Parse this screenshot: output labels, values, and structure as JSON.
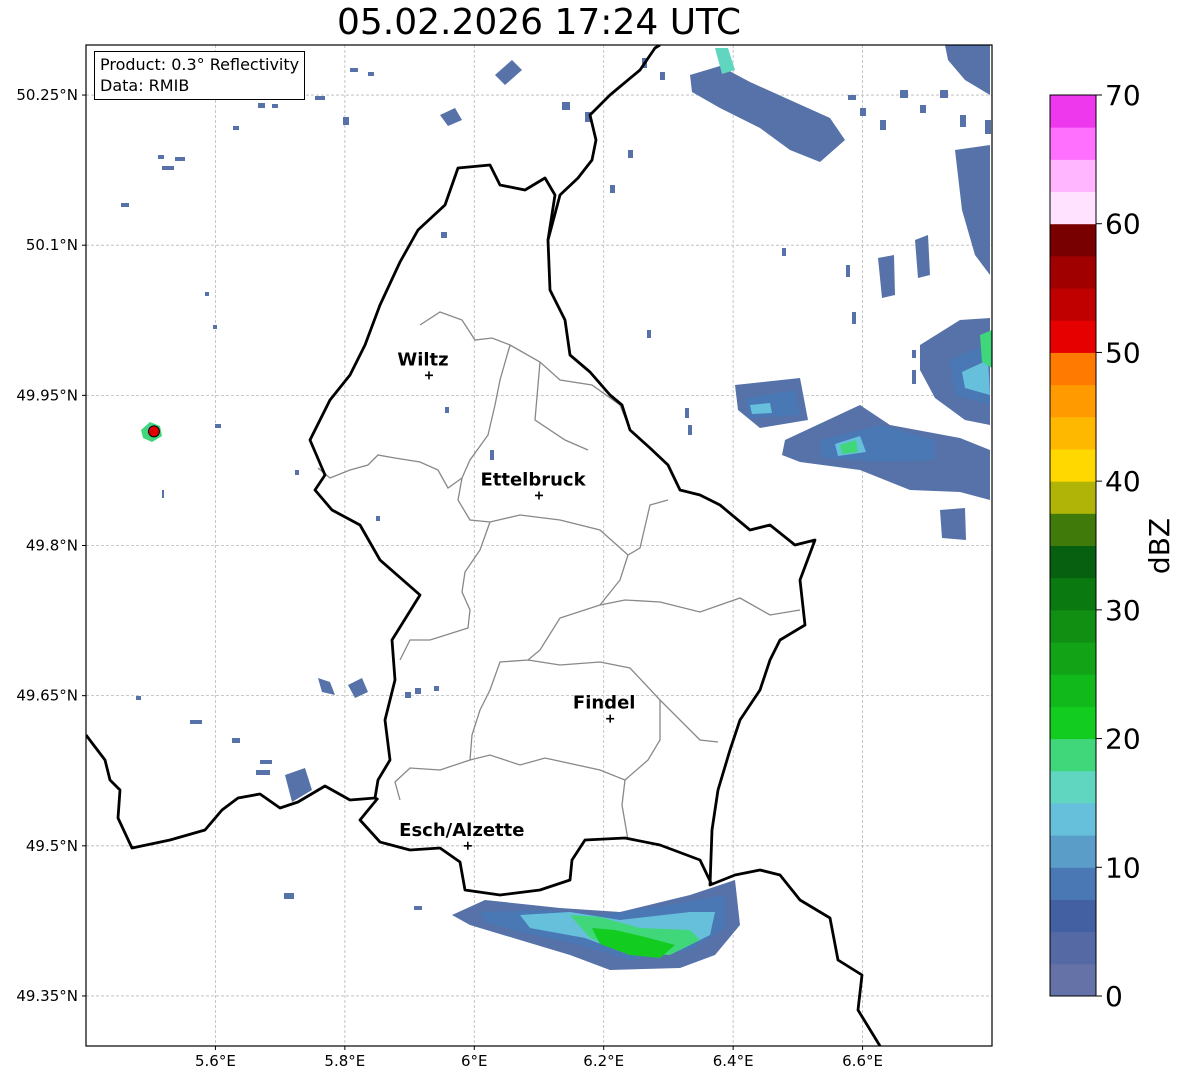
{
  "title": "05.02.2026 17:24 UTC",
  "info": {
    "product": "Product: 0.3° Reflectivity",
    "source": "Data: RMIB"
  },
  "lon_labels": [
    "5.6°E",
    "5.8°E",
    "6°E",
    "6.2°E",
    "6.4°E",
    "6.6°E"
  ],
  "lat_labels": [
    "50.25°N",
    "50.1°N",
    "49.95°N",
    "49.8°N",
    "49.65°N",
    "49.5°N",
    "49.35°N"
  ],
  "lon_values": [
    5.6,
    5.8,
    6.0,
    6.2,
    6.4,
    6.6
  ],
  "lat_values": [
    50.25,
    50.1,
    49.95,
    49.8,
    49.65,
    49.5,
    49.35
  ],
  "extent": {
    "lon": [
      5.4,
      6.8
    ],
    "lat": [
      49.3,
      50.3
    ]
  },
  "cities": [
    {
      "name": "Wiltz",
      "lon": 5.93,
      "lat": 49.97
    },
    {
      "name": "Ettelbruck",
      "lon": 6.1,
      "lat": 49.85
    },
    {
      "name": "Findel",
      "lon": 6.21,
      "lat": 49.627
    },
    {
      "name": "Esch/Alzette",
      "lon": 5.99,
      "lat": 49.5
    }
  ],
  "radar_site": {
    "lon": 5.505,
    "lat": 49.914,
    "color": "#e00000"
  },
  "colorbar": {
    "label": "dBZ",
    "tick_labels": [
      "0",
      "10",
      "20",
      "30",
      "40",
      "50",
      "60",
      "70"
    ],
    "min": 0,
    "max": 70,
    "step": 2.5,
    "colors": [
      "#6572a8",
      "#556aa4",
      "#4360a2",
      "#4a78b4",
      "#5a9dc8",
      "#66c0dc",
      "#60d6c0",
      "#40d67a",
      "#12cc20",
      "#12b91a",
      "#12a416",
      "#108f12",
      "#0a7a10",
      "#066010",
      "#407a0a",
      "#b0b406",
      "#ffd800",
      "#ffb800",
      "#ff9a00",
      "#ff7a00",
      "#e60000",
      "#c00000",
      "#a00000",
      "#780000",
      "#ffe2ff",
      "#ffb6ff",
      "#ff70ff",
      "#ee38ee"
    ]
  }
}
